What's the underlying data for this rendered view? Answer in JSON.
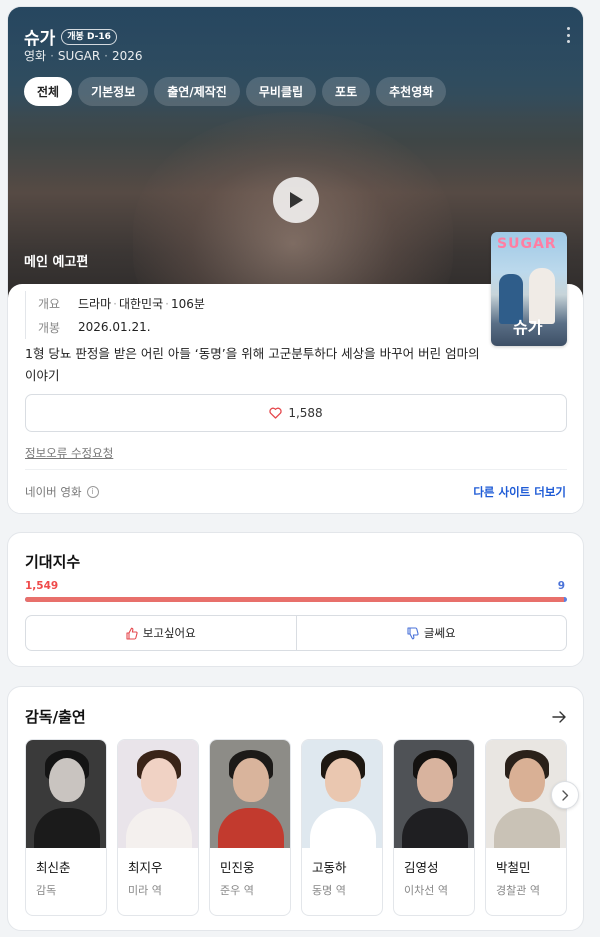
{
  "header": {
    "title": "슈가",
    "badge": "개봉 D-16",
    "category": "영화",
    "english_title": "SUGAR",
    "year": "2026"
  },
  "tabs": [
    {
      "label": "전체",
      "active": true
    },
    {
      "label": "기본정보",
      "active": false
    },
    {
      "label": "출연/제작진",
      "active": false
    },
    {
      "label": "무비클립",
      "active": false
    },
    {
      "label": "포토",
      "active": false
    },
    {
      "label": "추천영화",
      "active": false
    }
  ],
  "hero": {
    "label": "메인 예고편",
    "play_icon": "play-icon"
  },
  "poster": {
    "logo_text": "SUGAR",
    "title_text": "슈가"
  },
  "info": {
    "overview_key": "개요",
    "genre": "드라마",
    "country": "대한민국",
    "runtime": "106분",
    "release_key": "개봉",
    "release_date": "2026.01.21.",
    "synopsis": "1형 당뇨 판정을 받은 어린 아들 ‘동명’을 위해 고군분투하다 세상을 바꾸어 버린 엄마의 이야기",
    "like_count": "1,588",
    "report_link": "정보오류 수정요청",
    "source": "네이버 영화",
    "other_sites": "다른 사이트 더보기"
  },
  "anticipation": {
    "title": "기대지수",
    "want_count": "1,549",
    "dont_count": "9",
    "want_share": 0.9942,
    "want_label": "보고싶어요",
    "dont_label": "글쎄요"
  },
  "cast": {
    "title": "감독/출연",
    "members": [
      {
        "name": "최신춘",
        "role": "감독",
        "bg": "#3a3a3a",
        "skin": "#c9c4c0",
        "hair": "#141414",
        "cloth": "#1b1b1b"
      },
      {
        "name": "최지우",
        "role": "미라 역",
        "bg": "#e9e4ea",
        "skin": "#f0d2c4",
        "hair": "#3a2418",
        "cloth": "#f4f0ee"
      },
      {
        "name": "민진웅",
        "role": "준우 역",
        "bg": "#8d8c87",
        "skin": "#d9b49c",
        "hair": "#1c1a18",
        "cloth": "#c23a2e"
      },
      {
        "name": "고동하",
        "role": "동명 역",
        "bg": "#dfe8ef",
        "skin": "#eac7b0",
        "hair": "#1e1812",
        "cloth": "#ffffff"
      },
      {
        "name": "김영성",
        "role": "이차선 역",
        "bg": "#4f5256",
        "skin": "#d8b39e",
        "hair": "#141210",
        "cloth": "#1f1f22"
      },
      {
        "name": "박철민",
        "role": "경찰관 역",
        "bg": "#e9e6e2",
        "skin": "#d9b095",
        "hair": "#2a211a",
        "cloth": "#c9c2b6"
      }
    ]
  }
}
